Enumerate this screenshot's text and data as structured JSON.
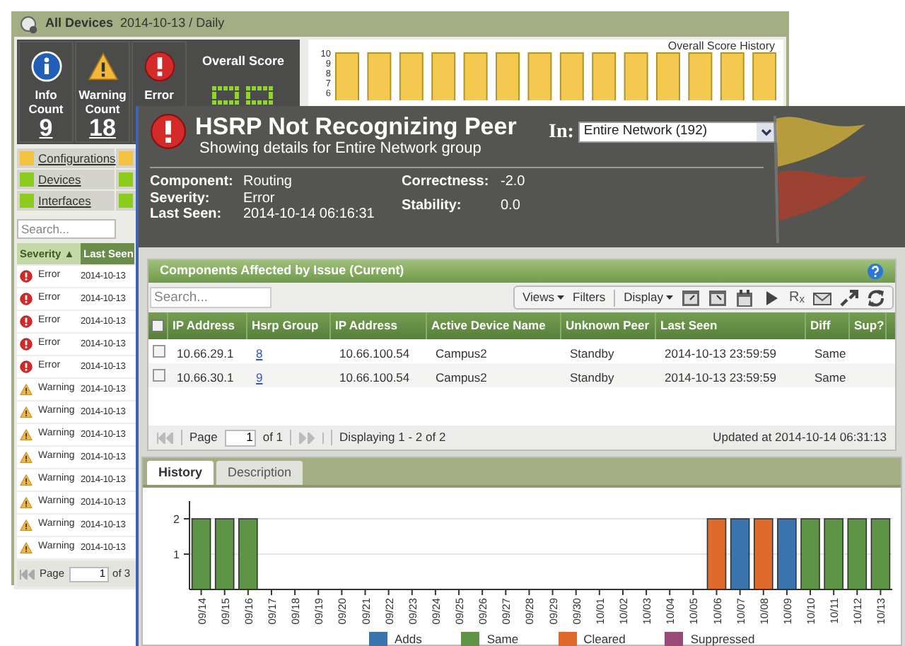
{
  "background_window": {
    "title": "All Devices",
    "subtitle": "2014-10-13 / Daily",
    "tiles": [
      {
        "kind": "info",
        "label": "Info Count",
        "count": "9"
      },
      {
        "kind": "warning",
        "label": "Warning Count",
        "count": "18"
      },
      {
        "kind": "error",
        "label": "Error"
      }
    ],
    "overall_score": {
      "label": "Overall Score"
    },
    "score_history": {
      "title": "Overall Score History",
      "y_tick_labels": [
        "10",
        "9",
        "8",
        "7",
        "6"
      ]
    },
    "categories": [
      {
        "label": "Configurations",
        "color": "#f2c240"
      },
      {
        "label": "Devices",
        "color": "#8ccc1c"
      },
      {
        "label": "Interfaces",
        "color": "#8ccc1c"
      }
    ],
    "categories_column_2": [
      {
        "color": "#f2c240"
      },
      {
        "color": "#8ccc1c"
      },
      {
        "color": "#8ccc1c"
      }
    ],
    "search": {
      "placeholder": "Search..."
    },
    "table": {
      "columns": [
        {
          "label": "Severity ▲",
          "sorted": true
        },
        {
          "label": "Last Seen",
          "sorted": false
        }
      ],
      "rows": [
        {
          "kind": "error",
          "severity": "Error",
          "last_seen": "2014-10-13"
        },
        {
          "kind": "error",
          "severity": "Error",
          "last_seen": "2014-10-13"
        },
        {
          "kind": "error",
          "severity": "Error",
          "last_seen": "2014-10-13"
        },
        {
          "kind": "error",
          "severity": "Error",
          "last_seen": "2014-10-13"
        },
        {
          "kind": "error",
          "severity": "Error",
          "last_seen": "2014-10-13"
        },
        {
          "kind": "warning",
          "severity": "Warning",
          "last_seen": "2014-10-13"
        },
        {
          "kind": "warning",
          "severity": "Warning",
          "last_seen": "2014-10-13"
        },
        {
          "kind": "warning",
          "severity": "Warning",
          "last_seen": "2014-10-13"
        },
        {
          "kind": "warning",
          "severity": "Warning",
          "last_seen": "2014-10-13"
        },
        {
          "kind": "warning",
          "severity": "Warning",
          "last_seen": "2014-10-13"
        },
        {
          "kind": "warning",
          "severity": "Warning",
          "last_seen": "2014-10-13"
        },
        {
          "kind": "warning",
          "severity": "Warning",
          "last_seen": "2014-10-13"
        },
        {
          "kind": "warning",
          "severity": "Warning",
          "last_seen": "2014-10-13"
        }
      ]
    },
    "pager": {
      "label": "Page",
      "page": "1",
      "of": "of 3"
    }
  },
  "popup": {
    "title": "HSRP Not Recognizing Peer",
    "subtitle": "Showing details for Entire Network group",
    "scope": {
      "label": "In:",
      "value": "Entire Network (192)"
    },
    "details": [
      {
        "label": "Component:",
        "value": "Routing"
      },
      {
        "label": "Severity:",
        "value": "Error"
      },
      {
        "label": "Last Seen:",
        "value": "2014-10-14 06:16:31"
      }
    ],
    "details_2": [
      {
        "label": "Correctness:",
        "value": "-2.0"
      },
      {
        "label": "Stability:",
        "value": "0.0"
      }
    ],
    "components": {
      "title": "Components Affected by Issue (Current)",
      "search": {
        "placeholder": "Search..."
      },
      "toolbar": [
        {
          "kind": "menu",
          "label": "Views"
        },
        {
          "kind": "text",
          "label": "Filters"
        },
        {
          "kind": "menu",
          "label": "Display"
        }
      ],
      "rx_button": "R$_{x}$",
      "table": {
        "header_checked": false,
        "columns": [
          "IP Address",
          "Hsrp Group",
          "IP Address",
          "Active Device Name",
          "Unknown Peer",
          "Last Seen",
          "Diff",
          "Sup?"
        ],
        "rows": [
          {
            "checked": false,
            "cells": [
              "10.66.29.1",
              "8",
              "10.66.100.54",
              "Campus2",
              "Standby",
              "2014-10-13 23:59:59",
              "Same"
            ]
          },
          {
            "checked": false,
            "cells": [
              "10.66.30.1",
              "9",
              "10.66.100.54",
              "Campus2",
              "Standby",
              "2014-10-13 23:59:59",
              "Same"
            ]
          }
        ]
      },
      "pager": {
        "label": "Page",
        "page": "1",
        "of": "of 1",
        "display": "Displaying 1 - 2 of 2",
        "updated": "Updated at 2014-10-14 06:31:13"
      }
    },
    "tabs": [
      {
        "label": "History",
        "selected": true
      },
      {
        "label": "Description",
        "selected": false
      }
    ],
    "chart_data": {
      "type": "bar",
      "stacked": true,
      "ylim": [
        0,
        2.5
      ],
      "legend": true,
      "categories": [
        "09/14",
        "09/15",
        "09/16",
        "09/17",
        "09/18",
        "09/19",
        "09/20",
        "09/21",
        "09/22",
        "09/23",
        "09/24",
        "09/25",
        "09/26",
        "09/27",
        "09/28",
        "09/29",
        "09/30",
        "10/01",
        "10/02",
        "10/03",
        "10/04",
        "10/05",
        "10/06",
        "10/07",
        "10/08",
        "10/09",
        "10/10",
        "10/11",
        "10/12",
        "10/13"
      ],
      "yticks": [
        1,
        2
      ],
      "series": [
        {
          "name": "Adds",
          "color": "#3a74b0",
          "values": [
            0,
            0,
            0,
            0,
            0,
            0,
            0,
            0,
            0,
            0,
            0,
            0,
            0,
            0,
            0,
            0,
            0,
            0,
            0,
            0,
            0,
            0,
            0,
            2,
            0,
            2,
            0,
            0,
            0,
            0
          ]
        },
        {
          "name": "Same",
          "color": "#5e9446",
          "values": [
            2,
            2,
            2,
            0,
            0,
            0,
            0,
            0,
            0,
            0,
            0,
            0,
            0,
            0,
            0,
            0,
            0,
            0,
            0,
            0,
            0,
            0,
            0,
            0,
            0,
            0,
            2,
            2,
            2,
            2
          ]
        },
        {
          "name": "Cleared",
          "color": "#e0692c",
          "values": [
            0,
            0,
            0,
            0,
            0,
            0,
            0,
            0,
            0,
            0,
            0,
            0,
            0,
            0,
            0,
            0,
            0,
            0,
            0,
            0,
            0,
            0,
            2,
            0,
            2,
            0,
            0,
            0,
            0,
            0
          ]
        },
        {
          "name": "Suppressed",
          "color": "#9a4a78",
          "values": [
            0,
            0,
            0,
            0,
            0,
            0,
            0,
            0,
            0,
            0,
            0,
            0,
            0,
            0,
            0,
            0,
            0,
            0,
            0,
            0,
            0,
            0,
            0,
            0,
            0,
            0,
            0,
            0,
            0,
            0
          ]
        }
      ]
    }
  }
}
